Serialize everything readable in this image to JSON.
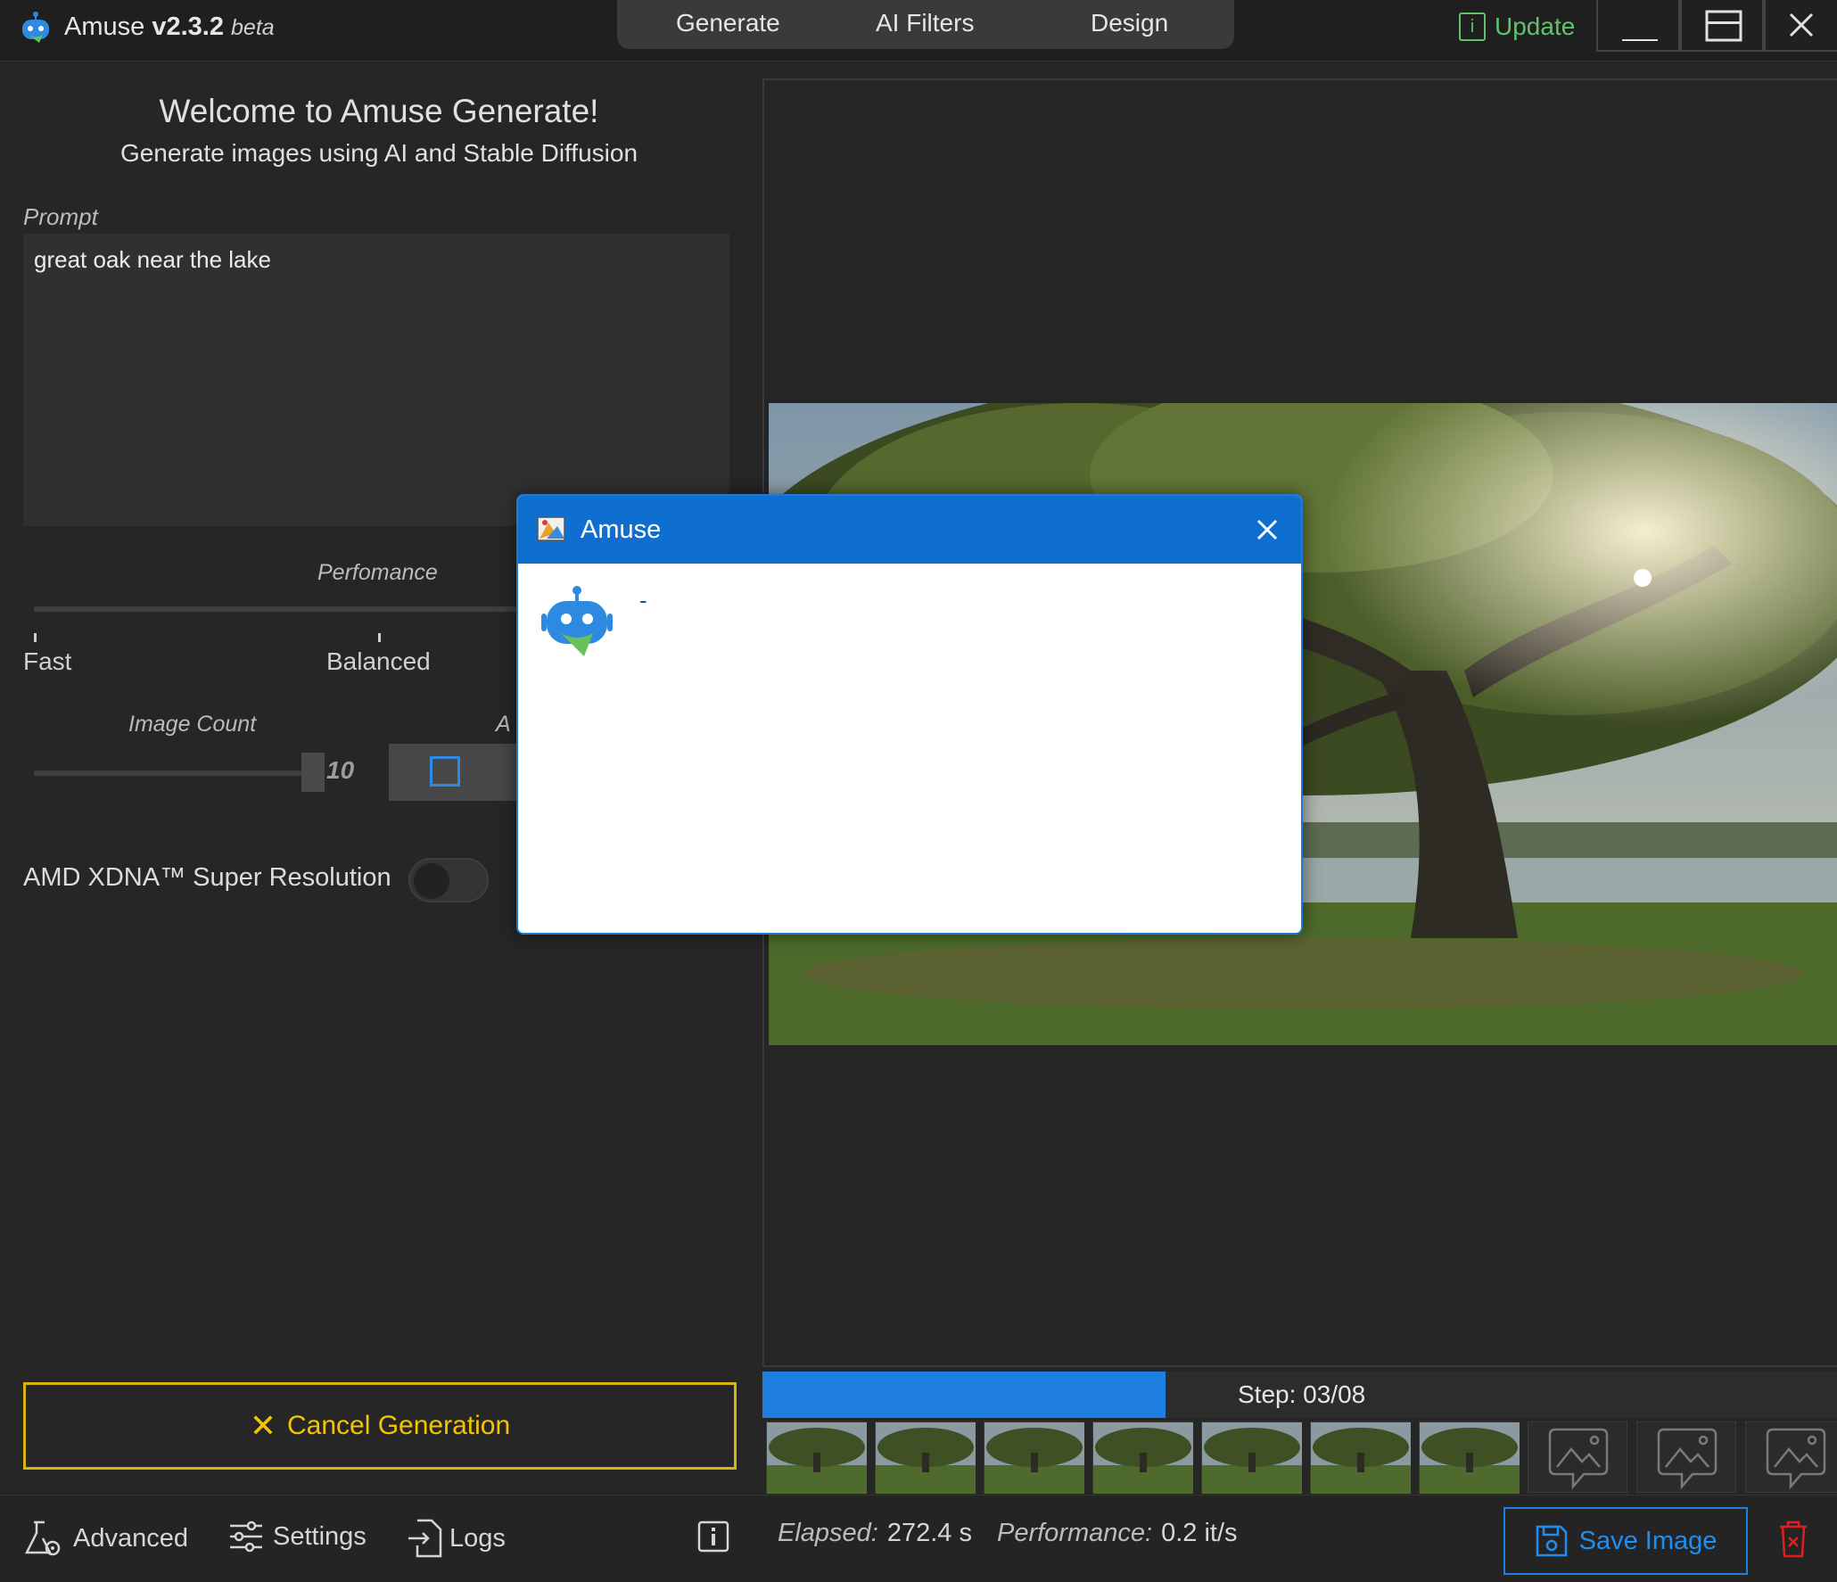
{
  "app": {
    "name": "Amuse",
    "version": "v2.3.2",
    "channel": "beta",
    "update_label": "Update"
  },
  "nav": {
    "tabs": [
      {
        "label": "Generate"
      },
      {
        "label": "AI Filters"
      },
      {
        "label": "Design"
      }
    ]
  },
  "left": {
    "welcome_title": "Welcome to Amuse Generate!",
    "welcome_subtitle": "Generate images using AI and Stable Diffusion",
    "prompt_label": "Prompt",
    "prompt_value": "great oak near the lake",
    "performance_label": "Perfomance",
    "performance_ticks": [
      "Fast",
      "Balanced"
    ],
    "image_count_label": "Image Count",
    "image_count_value": "10",
    "aspect_label_partial": "A",
    "super_resolution_label": "AMD XDNA™ Super Resolution",
    "super_resolution_on": false,
    "cancel_label": "Cancel Generation"
  },
  "preview": {
    "progress_fraction": 0.375,
    "step_text": "Step: 03/08",
    "thumbnail_count_filled": 7,
    "thumbnail_count_empty": 3
  },
  "status": {
    "advanced_label": "Advanced",
    "settings_label": "Settings",
    "logs_label": "Logs",
    "elapsed_label": "Elapsed:",
    "elapsed_value": "272.4 s",
    "performance_label": "Performance:",
    "performance_value": "0.2 it/s",
    "save_label": "Save Image"
  },
  "dialog": {
    "title": "Amuse",
    "message": "-"
  },
  "colors": {
    "accent_blue": "#1e7fe0",
    "update_green": "#62c26a",
    "cancel_yellow": "#f5c400",
    "delete_red": "#e02020"
  },
  "icons": {
    "app_logo": "robot-logo-icon",
    "update": "info-box-icon",
    "advanced": "flask-gear-icon",
    "settings": "sliders-icon",
    "logs": "log-file-icon",
    "info": "info-icon",
    "save": "floppy-disk-icon",
    "delete": "trash-icon"
  }
}
